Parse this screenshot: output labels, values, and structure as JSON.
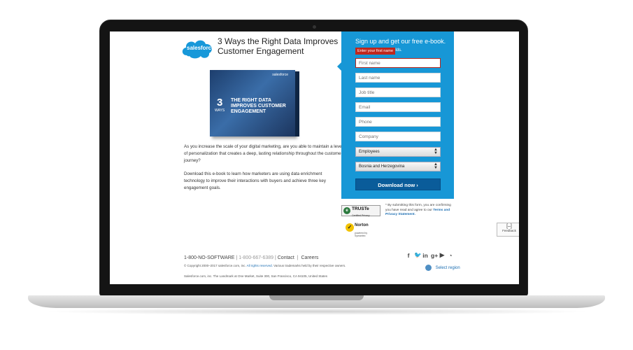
{
  "header": {
    "logo_text": "salesforce",
    "title": "3 Ways the Right Data Improves Customer Engagement"
  },
  "ebook": {
    "brand": "salesforce",
    "number": "3",
    "ways": "WAYS",
    "title": "THE RIGHT DATA IMPROVES CUSTOMER ENGAGEMENT"
  },
  "body": {
    "paragraph1": "As you increase the scale of your digital marketing, are you able to maintain a level of personalization that creates a deep, lasting relationship throughout the customer journey?",
    "paragraph2": "Download this e-book to learn how marketers are using data enrichment technology to improve their interactions with buyers and achieve three key engagement goals."
  },
  "form": {
    "heading": "Sign up and get our free e-book.",
    "fields_label": "fields.",
    "error_tip": "Enter your first name",
    "first_name": "First name",
    "last_name": "Last name",
    "job_title": "Job title",
    "email": "Email",
    "phone": "Phone",
    "company": "Company",
    "employees": "Employees",
    "country": "Bosnia and Herzegovina",
    "download_label": "Download now ›",
    "colors": {
      "panel": "#1797d6",
      "button": "#0a5c9a",
      "error": "#c0271d"
    }
  },
  "trust": {
    "truste": "TRUSTe",
    "truste_sub": "Certified Privacy",
    "norton": "Norton",
    "norton_sub": "powered by Symantec",
    "legal_text": "* By submitting this form, you are confirming you have read and agree to our",
    "legal_link": "Terms and Privacy Statement."
  },
  "feedback": {
    "icon": "[–]",
    "label": "Feedback"
  },
  "footer": {
    "phone_word": "1-800-NO-SOFTWARE",
    "phone_number": "1-800-667-6389",
    "contact": "Contact",
    "careers": "Careers",
    "copyright": "© Copyright 2000–2017 salesforce.com, inc.",
    "rights": "All rights reserved.",
    "trademark": "Various trademarks held by their respective owners.",
    "address": "Salesforce.com, inc. The Landmark at One Market, Suite 300, San Francisco, CA 94105, United States",
    "social": [
      "f",
      "t",
      "in",
      "g+",
      "yt",
      "rss"
    ],
    "select_region": "Select region"
  }
}
